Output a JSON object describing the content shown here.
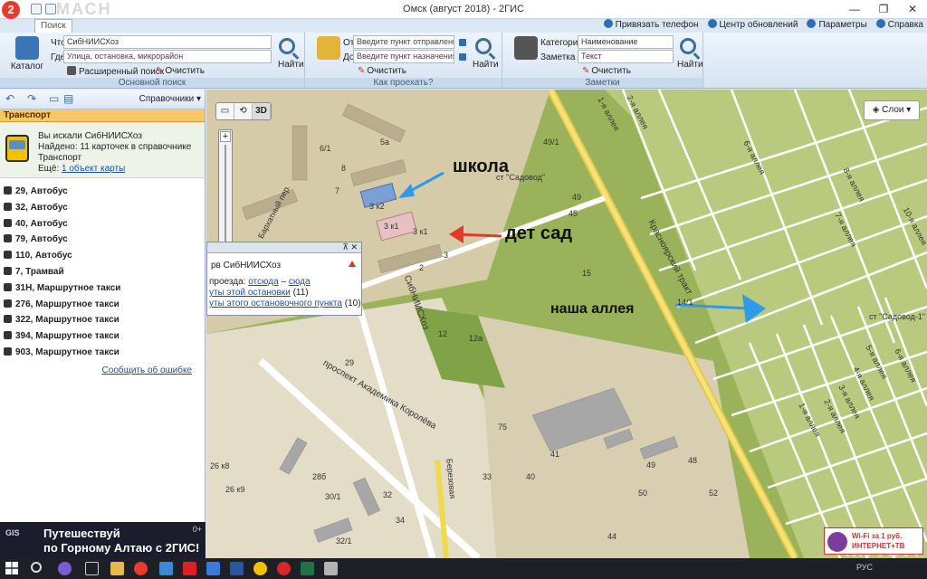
{
  "window": {
    "title": "Омск (август 2018) - 2ГИС",
    "logo_text": "2",
    "watermark": "МАСН",
    "controls": [
      "—",
      "❐",
      "✕"
    ]
  },
  "ribbon_tabs": {
    "active_tab": "Поиск",
    "links": [
      "Привязать телефон",
      "Центр обновлений",
      "Параметры",
      "Справка"
    ]
  },
  "search_group": {
    "catalog_label": "Каталог",
    "what_label": "Что",
    "what_value": "СибНИИСХоз",
    "where_label": "Где",
    "where_placeholder": "Улица, остановка, микрорайон",
    "find_label": "Найти",
    "advanced_label": "Расширенный поиск",
    "clear_label": "Очистить",
    "group_label": "Основной поиск"
  },
  "route_group": {
    "from_label": "От",
    "from_placeholder": "Введите пункт отправления",
    "to_label": "До",
    "to_placeholder": "Введите пункт назначения",
    "find_label": "Найти",
    "clear_label": "Очистить",
    "group_label": "Как проехать?"
  },
  "notes_group": {
    "category_label": "Категория",
    "category_value": "Наименование",
    "note_label": "Заметка",
    "note_value": "Текст",
    "find_label": "Найти",
    "clear_label": "Очистить",
    "group_label": "Заметки"
  },
  "left_panel": {
    "reference_label": "Справочники",
    "section_title": "Транспорт",
    "summary": {
      "line1": "Вы искали СибНИИСХоз",
      "line2": "Найдено: 11 карточек в справочнике",
      "line3": "Транспорт",
      "line4_prefix": "Ещё:",
      "line4_link": "1 объект карты"
    },
    "routes": [
      "29, Автобус",
      "32, Автобус",
      "40, Автобус",
      "79, Автобус",
      "110, Автобус",
      "7, Трамвай",
      "31Н, Маршрутное такси",
      "276, Маршрутное такси",
      "322, Маршрутное такси",
      "394, Маршрутное такси",
      "903, Маршрутное такси"
    ],
    "report_link": "Сообщить об ошибке"
  },
  "ad_banner": {
    "logo": "GIS",
    "line1": "Путешествуй",
    "line2": "по Горному Алтаю с 2ГИС!",
    "age": "0+"
  },
  "map": {
    "tool_ruler": "▭",
    "tool_hand": "⟲",
    "tool_3d": "3D",
    "zoom_in": "+",
    "zoom_out": "−",
    "layers_label": "Слои",
    "popup": {
      "controls": "⊼ ✕",
      "title": "рв СибНИИСХоз",
      "line1_prefix": "проезда:",
      "line1_from": "отсюда",
      "line1_dash": "–",
      "line1_to": "сюда",
      "line2_link": "уты этой остановки",
      "line2_count": "(11)",
      "line3_link": "уты этого остановочного пункта",
      "line3_count": "(10)"
    },
    "annotations": {
      "school": "школа",
      "kindergarten": "дет сад",
      "our_alley": "наша аллея"
    },
    "street_labels": [
      "Бархатный пер.",
      "СибНИИСХоз",
      "проспект Академика Королёва",
      "Березовая",
      "Красноярский тракт",
      "ст \"Садовод\"",
      "ст \"Садовод-1\"",
      "6-я аллея",
      "8-я аллея",
      "7-я аллея",
      "10-я аллея",
      "5-я аллея",
      "6-я аллея",
      "4-я аллея",
      "3-я аллея",
      "2-я аллея",
      "1-я аллея",
      "1-я аллея",
      "2-я аллея"
    ],
    "house_numbers": [
      "5а",
      "6/1",
      "7",
      "8",
      "3 к2",
      "3 к1",
      "3 к1",
      "3",
      "2",
      "49/1",
      "49",
      "45",
      "15",
      "12",
      "12а",
      "29",
      "75",
      "41",
      "40",
      "49",
      "48",
      "50",
      "33",
      "44",
      "52",
      "26 к8",
      "28б",
      "26 к9",
      "30/1",
      "32",
      "34",
      "32/1",
      "14/1"
    ],
    "corner_ad": {
      "line1": "Wi-Fi за 1 руб.",
      "line2": "ИНТЕРНЕТ+ТВ"
    }
  },
  "taskbar": {
    "tray_text": "РУС"
  },
  "colors": {
    "accent": "#2f6db3",
    "section_bg": "#f7c76a",
    "map_green": "#9ab35b",
    "map_sand": "#d9cfb0",
    "road_yellow": "#f2d84d"
  }
}
